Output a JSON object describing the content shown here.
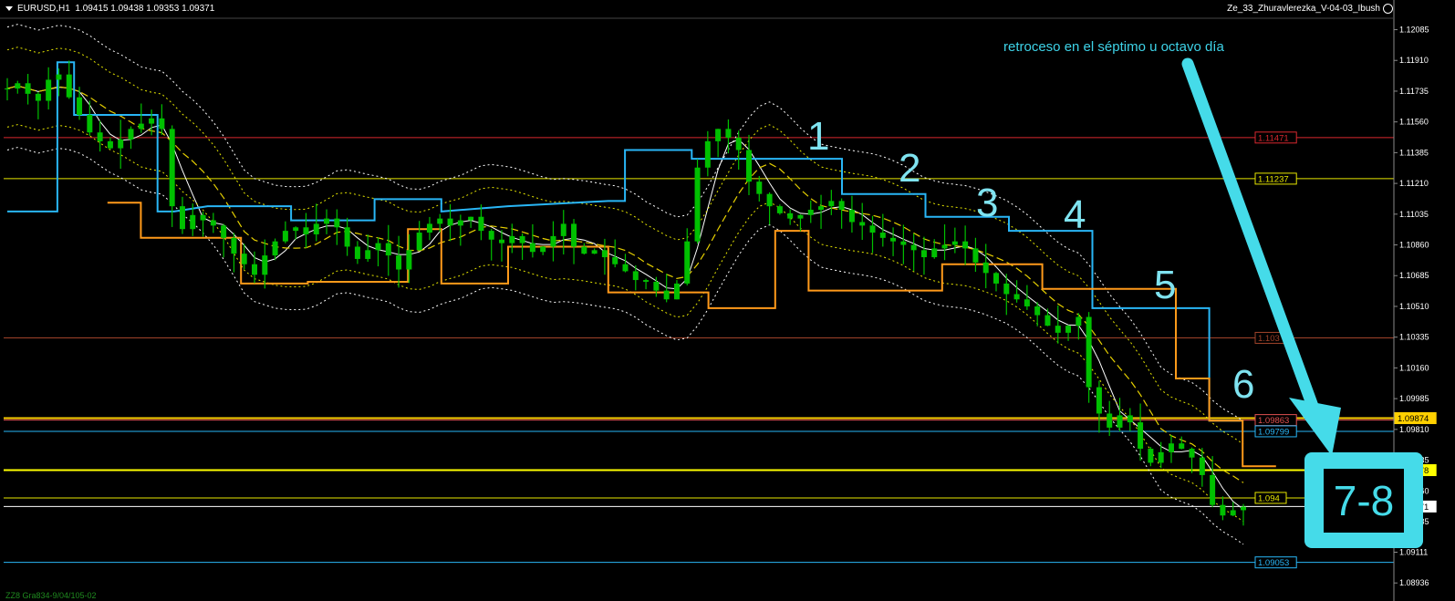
{
  "header": {
    "symbol_timeframe": "EURUSD,H1",
    "ohlc": "1.09415 1.09438 1.09353 1.09371",
    "indicator_name": "Ze_33_Zhuravlerezka_V-04-03_Ibush"
  },
  "footer_text": "ZZ8 Gra834-9/04/105-02",
  "annotation": "retroceso en el séptimo u octavo día",
  "counts": [
    "1",
    "2",
    "3",
    "4",
    "5",
    "6"
  ],
  "big_label": "7-8",
  "colors": {
    "background": "#000000",
    "candles": "#00c000",
    "cyan_steps": "#29b6f6",
    "orange_steps": "#ff9a1a",
    "yellow_dots": "#e6e600",
    "white_dots": "#ffffff",
    "annotation": "#45dbe9"
  },
  "chart_data": {
    "type": "line",
    "title": "",
    "y_axis": {
      "min": 1.0888,
      "max": 1.1215,
      "ticks": [
        "1.12085",
        "1.11910",
        "1.11735",
        "1.11560",
        "1.11385",
        "1.11210",
        "1.11035",
        "1.10860",
        "1.10685",
        "1.10510",
        "1.10335",
        "1.10160",
        "1.09985",
        "1.09810",
        "1.09635",
        "1.09460",
        "1.09285",
        "1.09111",
        "1.08936"
      ]
    },
    "levels": [
      {
        "value": 1.11471,
        "label": "1.11471",
        "color": "#d9282f"
      },
      {
        "value": 1.11237,
        "label": "1.11237",
        "color": "#e6e600"
      },
      {
        "value": 1.10331,
        "label": "1.103",
        "color": "#a0432a"
      },
      {
        "value": 1.09874,
        "label": "1.09874",
        "color": "#ffd000"
      },
      {
        "value": 1.09863,
        "label": "1.09863",
        "color": "#e05050"
      },
      {
        "value": 1.09799,
        "label": "1.09799",
        "color": "#29b6f6"
      },
      {
        "value": 1.09578,
        "label": "1.09578",
        "color": "#ffff00"
      },
      {
        "value": 1.0942,
        "label": "1.094",
        "color": "#e6e600"
      },
      {
        "value": 1.09371,
        "label": "1.09371",
        "color": "#ffffff"
      },
      {
        "value": 1.09053,
        "label": "1.09053",
        "color": "#29b6f6"
      }
    ],
    "series": [
      {
        "name": "",
        "values": [
          1.1175,
          1.1178,
          1.1172,
          1.1168,
          1.118,
          1.1183,
          1.117,
          1.116,
          1.115,
          1.1145,
          1.1141,
          1.1146,
          1.1152,
          1.1155,
          1.1158,
          1.1152,
          1.1108,
          1.1095,
          1.1103,
          1.11,
          1.1097,
          1.109,
          1.1081,
          1.1075,
          1.1069,
          1.108,
          1.1088,
          1.1094,
          1.1096,
          1.1092,
          1.1098,
          1.1101,
          1.1096,
          1.1085,
          1.1078,
          1.1083,
          1.1087,
          1.108,
          1.1072,
          1.1083,
          1.1093,
          1.1098,
          1.1101,
          1.1097,
          1.11,
          1.1102,
          1.1094,
          1.1089,
          1.1087,
          1.1091,
          1.1087,
          1.1082,
          1.1085,
          1.1091,
          1.1098,
          1.1085,
          1.1081,
          1.1083,
          1.1079,
          1.1075,
          1.1071,
          1.1066,
          1.1065,
          1.106,
          1.1055,
          1.1064,
          1.1088,
          1.113,
          1.1145,
          1.1152,
          1.1147,
          1.114,
          1.1122,
          1.1115,
          1.1108,
          1.1104,
          1.1101,
          1.1103,
          1.1106,
          1.1108,
          1.1111,
          1.1106,
          1.1099,
          1.1097,
          1.1093,
          1.109,
          1.1088,
          1.1086,
          1.1083,
          1.1079,
          1.1084,
          1.1086,
          1.1088,
          1.1084,
          1.1076,
          1.107,
          1.1064,
          1.1058,
          1.1055,
          1.1051,
          1.1046,
          1.104,
          1.1036,
          1.104,
          1.1045,
          1.1005,
          1.099,
          1.0982,
          1.0989,
          1.0985,
          1.097,
          1.0962,
          1.0968,
          1.0973,
          1.097,
          1.0965,
          1.0955,
          1.0938,
          1.0932,
          1.0935,
          1.0937
        ]
      },
      {
        "name": "",
        "steps": [
          [
            0,
            1.1105
          ],
          [
            3,
            1.1105
          ],
          [
            3,
            1.119
          ],
          [
            4,
            1.119
          ],
          [
            4,
            1.116
          ],
          [
            9,
            1.116
          ],
          [
            9,
            1.1105
          ],
          [
            10,
            1.1105
          ],
          [
            12,
            1.1108
          ],
          [
            17,
            1.1108
          ],
          [
            17,
            1.11
          ],
          [
            22,
            1.11
          ],
          [
            22,
            1.1112
          ],
          [
            26,
            1.1112
          ],
          [
            26,
            1.1105
          ],
          [
            30,
            1.1108
          ],
          [
            36,
            1.1111
          ],
          [
            37,
            1.1111
          ],
          [
            37,
            1.114
          ],
          [
            41,
            1.114
          ],
          [
            41,
            1.1135
          ],
          [
            50,
            1.1135
          ],
          [
            50,
            1.1115
          ],
          [
            55,
            1.1115
          ],
          [
            55,
            1.1102
          ],
          [
            60,
            1.1102
          ],
          [
            60,
            1.1094
          ],
          [
            65,
            1.1094
          ],
          [
            65,
            1.105
          ],
          [
            69,
            1.105
          ],
          [
            69,
            1.105
          ],
          [
            72,
            1.105
          ],
          [
            72,
            1.0986
          ],
          [
            74,
            1.0986
          ]
        ]
      },
      {
        "name": "",
        "steps": [
          [
            3,
            1.111
          ],
          [
            4,
            1.111
          ],
          [
            4,
            1.109
          ],
          [
            7,
            1.109
          ],
          [
            7,
            1.1064
          ],
          [
            9,
            1.1064
          ],
          [
            9,
            1.1065
          ],
          [
            12,
            1.1065
          ],
          [
            12,
            1.1095
          ],
          [
            13,
            1.1095
          ],
          [
            13,
            1.1064
          ],
          [
            15,
            1.1064
          ],
          [
            15,
            1.1085
          ],
          [
            18,
            1.1085
          ],
          [
            18,
            1.1059
          ],
          [
            21,
            1.1059
          ],
          [
            21,
            1.105
          ],
          [
            23,
            1.105
          ],
          [
            23,
            1.1094
          ],
          [
            24,
            1.1094
          ],
          [
            24,
            1.106
          ],
          [
            28,
            1.106
          ],
          [
            28,
            1.1075
          ],
          [
            31,
            1.1075
          ],
          [
            31,
            1.1061
          ],
          [
            35,
            1.1061
          ],
          [
            35,
            1.101
          ],
          [
            36,
            1.101
          ],
          [
            36,
            1.0986
          ],
          [
            37,
            1.0986
          ],
          [
            37,
            1.096
          ],
          [
            38,
            1.096
          ]
        ]
      }
    ]
  }
}
